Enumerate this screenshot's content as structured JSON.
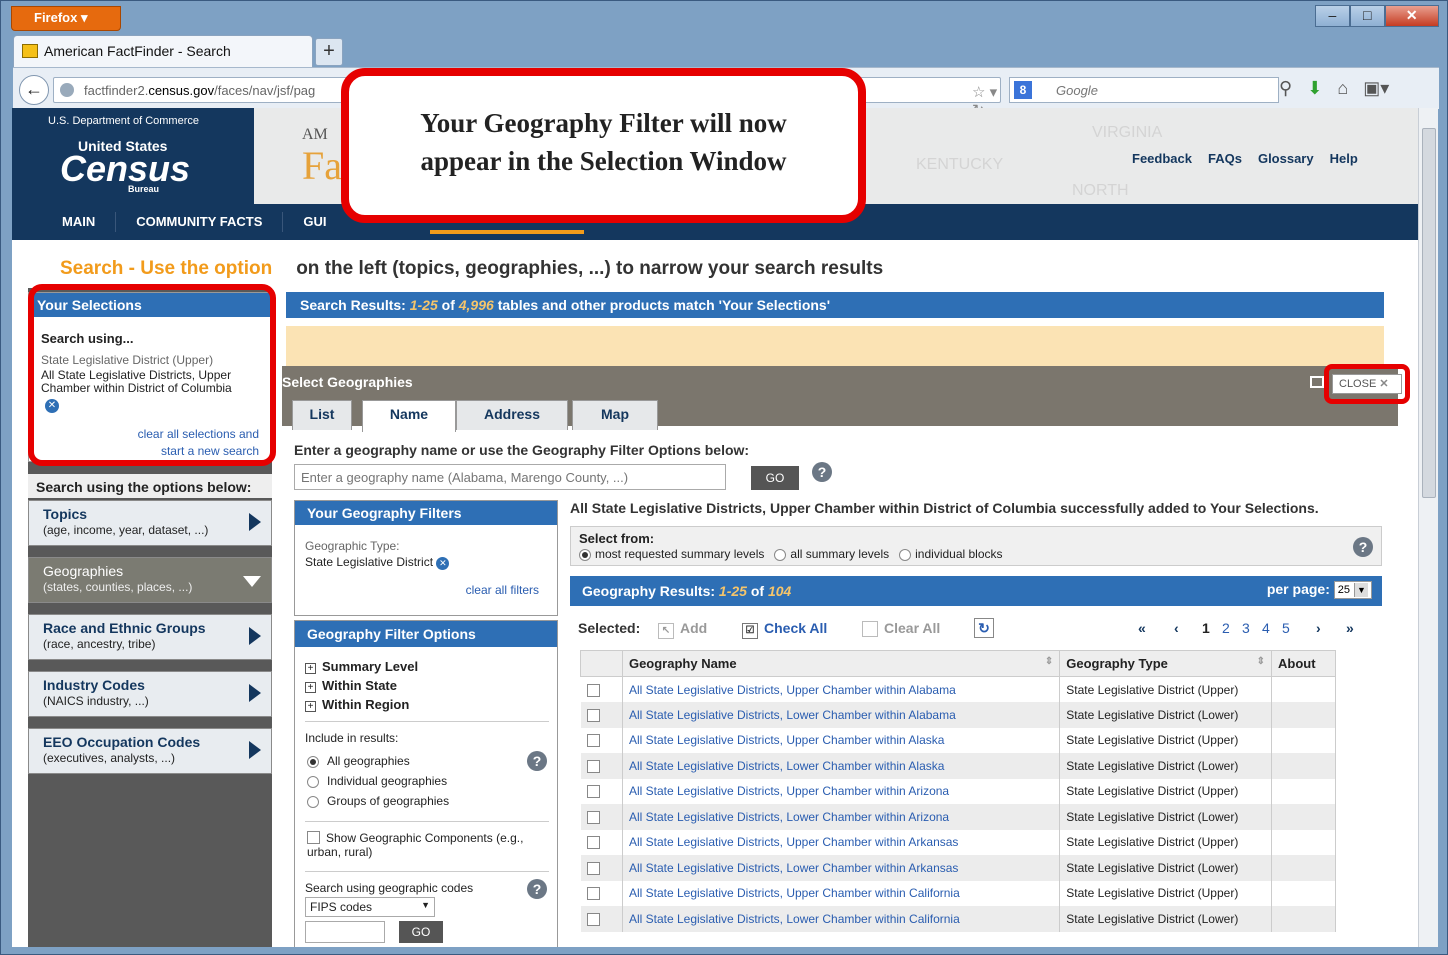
{
  "browser": {
    "app_button": "Firefox",
    "tab_title": "American FactFinder - Search",
    "url_prefix": "factfinder2.",
    "url_domain": "census.gov",
    "url_rest": "/faces/nav/jsf/pag",
    "search_engine": "Google"
  },
  "header": {
    "dept": "U.S. Department of Commerce",
    "us": "United States",
    "census": "Census",
    "bureau": "Bureau",
    "ff_small": "AM",
    "ff_big": "Fa",
    "map_labels": [
      "VIRGINIA",
      "KENTUCKY",
      "NORTH"
    ],
    "links": [
      "Feedback",
      "FAQs",
      "Glossary",
      "Help"
    ]
  },
  "mainnav": [
    "MAIN",
    "COMMUNITY FACTS",
    "GUI"
  ],
  "search_title": {
    "word": "Search",
    "rest": " - Use the option",
    "rest2": "on the left (topics, geographies, ...) to narrow your search results"
  },
  "selections": {
    "header": "Your Selections",
    "search_using": "Search using...",
    "type": "State Legislative District (Upper)",
    "value": "All State Legislative Districts, Upper Chamber within District of Columbia",
    "clear1": "clear all selections and",
    "clear2": "start a new search"
  },
  "options": {
    "header": "Search using the options below:",
    "cats": [
      {
        "title": "Topics",
        "sub": "(age, income, year, dataset, ...)"
      },
      {
        "title": "Geographies",
        "sub": "(states, counties, places, ...)"
      },
      {
        "title": "Race and Ethnic Groups",
        "sub": "(race, ancestry, tribe)"
      },
      {
        "title": "Industry Codes",
        "sub": "(NAICS industry, ...)"
      },
      {
        "title": "EEO Occupation Codes",
        "sub": "(executives, analysts, ...)"
      }
    ]
  },
  "results": {
    "label": "Search Results:",
    "range": "1-25",
    "of": "of",
    "total": "4,996",
    "rest": "tables and other products match 'Your Selections'",
    "per_page": "per page:",
    "per_page_val": "25"
  },
  "dialog": {
    "title": "Select Geographies",
    "close": "CLOSE",
    "tabs": [
      "List",
      "Name",
      "Address",
      "Map"
    ],
    "enter_label": "Enter a geography name or use the Geography Filter Options below:",
    "input_placeholder": "Enter a geography name (Alabama, Marengo County, ...)",
    "go": "GO",
    "filters_header": "Your Geography Filters",
    "geo_type_label": "Geographic Type:",
    "geo_type_value": "State Legislative District",
    "clear_filters": "clear all filters",
    "filter_options_header": "Geography Filter Options",
    "tree": [
      "Summary Level",
      "Within State",
      "Within Region"
    ],
    "include_label": "Include in results:",
    "include_opts": [
      "All geographies",
      "Individual geographies",
      "Groups of geographies"
    ],
    "show_components": "Show Geographic Components (e.g., urban, rural)",
    "codes_label": "Search using geographic codes",
    "codes_select": "FIPS codes",
    "success": "All State Legislative Districts, Upper Chamber within District of Columbia successfully added to Your Selections.",
    "select_from": "Select from:",
    "select_opts": [
      "most requested summary levels",
      "all summary levels",
      "individual blocks"
    ],
    "geo_results_label": "Geography Results:",
    "geo_range": "1-25",
    "geo_of": "of",
    "geo_total": "104",
    "selected": "Selected:",
    "add": "Add",
    "check_all": "Check All",
    "clear_all": "Clear All",
    "pages": [
      "1",
      "2",
      "3",
      "4",
      "5"
    ],
    "col_name": "Geography Name",
    "col_type": "Geography Type",
    "col_about": "About",
    "rows": [
      {
        "name": "All State Legislative Districts, Upper Chamber within Alabama",
        "type": "State Legislative District (Upper)"
      },
      {
        "name": "All State Legislative Districts, Lower Chamber within Alabama",
        "type": "State Legislative District (Lower)"
      },
      {
        "name": "All State Legislative Districts, Upper Chamber within Alaska",
        "type": "State Legislative District (Upper)"
      },
      {
        "name": "All State Legislative Districts, Lower Chamber within Alaska",
        "type": "State Legislative District (Lower)"
      },
      {
        "name": "All State Legislative Districts, Upper Chamber within Arizona",
        "type": "State Legislative District (Upper)"
      },
      {
        "name": "All State Legislative Districts, Lower Chamber within Arizona",
        "type": "State Legislative District (Lower)"
      },
      {
        "name": "All State Legislative Districts, Upper Chamber within Arkansas",
        "type": "State Legislative District (Upper)"
      },
      {
        "name": "All State Legislative Districts, Lower Chamber within Arkansas",
        "type": "State Legislative District (Lower)"
      },
      {
        "name": "All State Legislative Districts, Upper Chamber within California",
        "type": "State Legislative District (Upper)"
      },
      {
        "name": "All State Legislative Districts, Lower Chamber within California",
        "type": "State Legislative District (Lower)"
      }
    ]
  },
  "callout": {
    "line1": "Your Geography Filter will now",
    "line2": "appear in the Selection Window"
  }
}
